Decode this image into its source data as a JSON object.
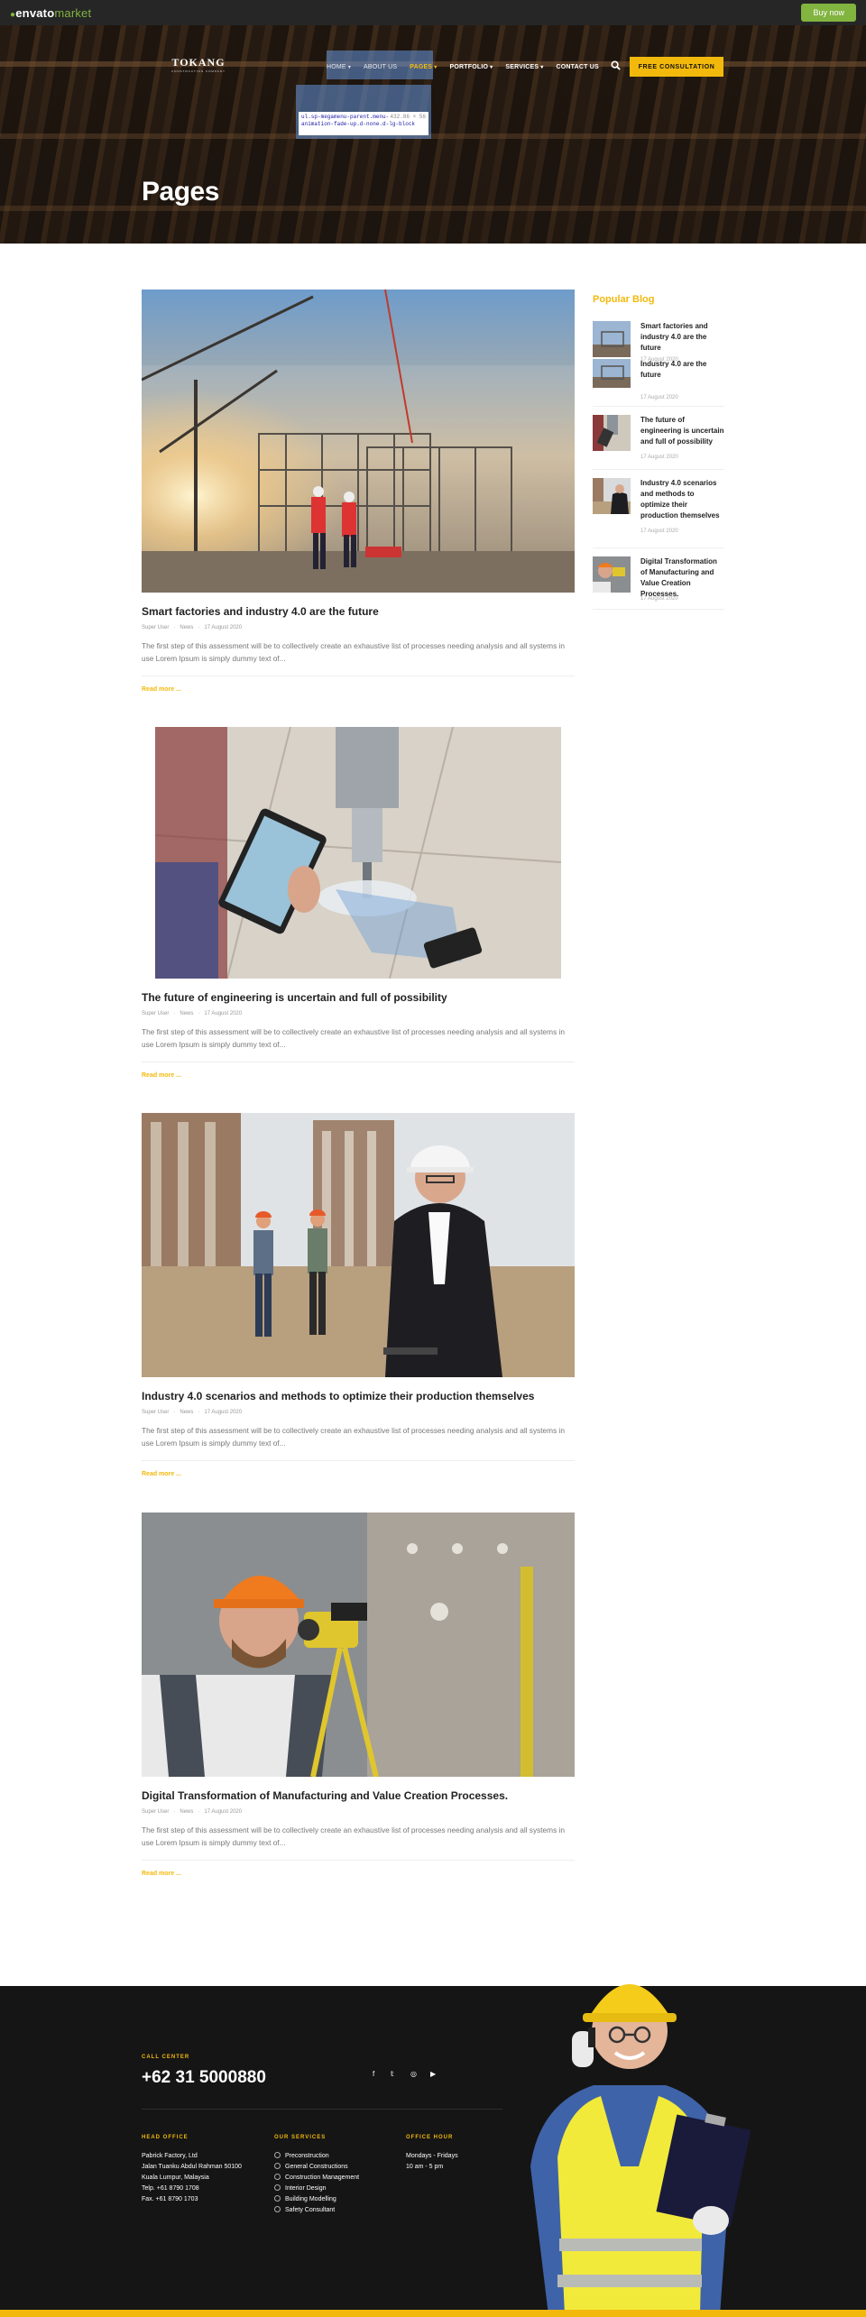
{
  "envato": {
    "logo_main": "envato",
    "logo_market": "market",
    "buy_label": "Buy now",
    "accent": "#82b440"
  },
  "header": {
    "brand": "TOKANG",
    "brand_tag": "CONSTRUCTION COMPANY",
    "nav": [
      {
        "label": "HOME",
        "caret": true
      },
      {
        "label": "ABOUT US",
        "caret": false
      },
      {
        "label": "PAGES",
        "caret": true
      },
      {
        "label": "PORTFOLIO",
        "caret": true
      },
      {
        "label": "SERVICES",
        "caret": true
      },
      {
        "label": "CONTACT US",
        "caret": false
      }
    ],
    "cta": "FREE CONSULTATION",
    "accent": "#f2b90c"
  },
  "inspector": {
    "selector": "ul.sp-megamenu-parent.menu-animation-fade-up.d-none.d-lg-block",
    "dims": "432.86 × 56"
  },
  "hero": {
    "title": "Pages"
  },
  "posts": [
    {
      "title": "Smart factories and industry 4.0 are the future",
      "author": "Super User",
      "category": "News",
      "date": "17 August 2020",
      "excerpt": "The first step of this assessment will be to collectively create an exhaustive list of processes needing analysis and all systems in use Lorem Ipsum is simply dummy text of...",
      "more": "Read more ..."
    },
    {
      "title": "The future of engineering is uncertain and full of possibility",
      "author": "Super User",
      "category": "News",
      "date": "17 August 2020",
      "excerpt": "The first step of this assessment will be to collectively create an exhaustive list of processes needing analysis and all systems in use Lorem Ipsum is simply dummy text of...",
      "more": "Read more ..."
    },
    {
      "title": "Industry 4.0 scenarios and methods to optimize their production themselves",
      "author": "Super User",
      "category": "News",
      "date": "17 August 2020",
      "excerpt": "The first step of this assessment will be to collectively create an exhaustive list of processes needing analysis and all systems in use Lorem Ipsum is simply dummy text of...",
      "more": "Read more ..."
    },
    {
      "title": "Digital Transformation of Manufacturing and Value Creation Processes.",
      "author": "Super User",
      "category": "News",
      "date": "17 August 2020",
      "excerpt": "The first step of this assessment will be to collectively create an exhaustive list of processes needing analysis and all systems in use Lorem Ipsum is simply dummy text of...",
      "more": "Read more ..."
    }
  ],
  "sidebar": {
    "title": "Popular Blog",
    "items": [
      {
        "title": "Smart factories and industry 4.0 are the future",
        "date": "17 August 2020"
      },
      {
        "title": "Industry 4.0 are the future",
        "date": "17 August 2020"
      },
      {
        "title": "The future of engineering is uncertain and full of possibility",
        "date": "17 August 2020"
      },
      {
        "title": "Industry 4.0 scenarios and methods to optimize their production themselves",
        "date": "17 August 2020"
      },
      {
        "title": "Digital Transformation of Manufacturing and Value Creation Processes.",
        "date": "17 August 2020"
      }
    ]
  },
  "footer": {
    "call_label": "CALL CENTER",
    "phone": "+62 31 5000880",
    "social": [
      "facebook-icon",
      "twitter-icon",
      "instagram-icon",
      "youtube-icon"
    ],
    "head_office": {
      "title": "HEAD OFFICE",
      "lines": [
        "Pabrick Factory, Ltd",
        "Jalan Tuanku Abdul Rahman 50100",
        "Kuala Lumpur, Malaysia",
        "Telp. +61 8790 1708",
        "Fax. +61 8790 1703"
      ]
    },
    "services": {
      "title": "OUR SERVICES",
      "items": [
        "Preconstruction",
        "General Constructions",
        "Construction Management",
        "Interior Design",
        "Building Modelling",
        "Safety Consultant"
      ]
    },
    "hours": {
      "title": "OFFICE HOUR",
      "lines": [
        "Mondays - Fridays",
        "10 am - 5 pm"
      ]
    }
  }
}
